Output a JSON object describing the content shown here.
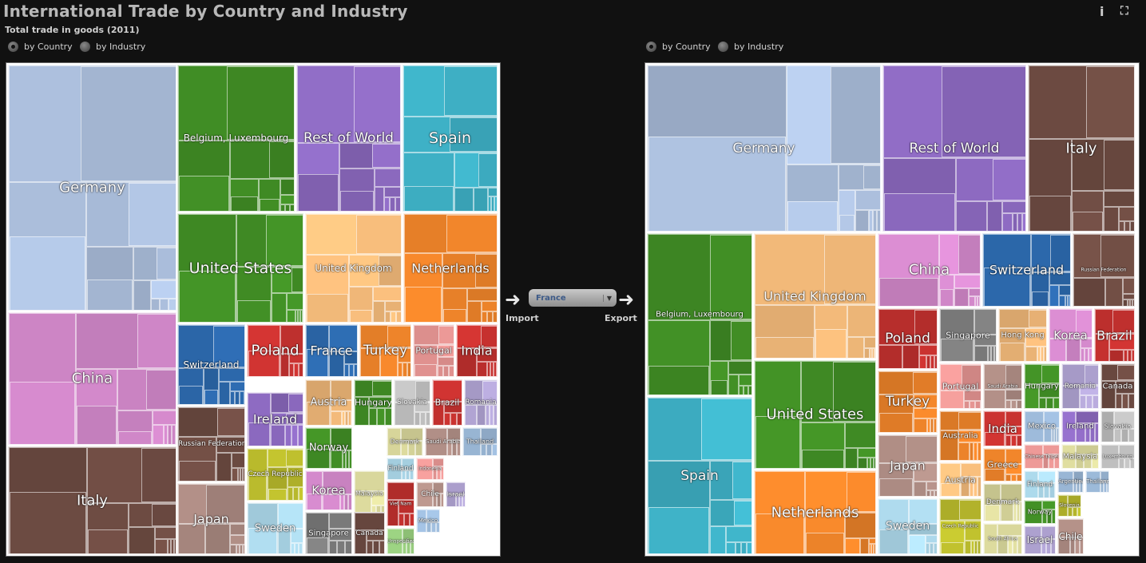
{
  "header": {
    "title": "International Trade by Country and Industry",
    "subtitle": "Total trade in goods (2011)",
    "info_icon": "info-icon",
    "fullscreen_icon": "fullscreen-icon"
  },
  "left_toggle": {
    "by_country": "by Country",
    "by_industry": "by Industry",
    "selected": "by Country"
  },
  "right_toggle": {
    "by_country": "by Country",
    "by_industry": "by Industry",
    "selected": "by Country"
  },
  "center": {
    "country": "France",
    "import_label": "Import",
    "export_label": "Export"
  },
  "colors": {
    "Germany": "#a9bcd9",
    "China": "#cf86c7",
    "Italy": "#6d4b42",
    "Belgium, Luxembourg": "#3f8a24",
    "Rest of World": "#8a68bd",
    "Spain": "#3eb0c5",
    "United States": "#3f8a24",
    "United Kingdom": "#efb778",
    "Netherlands": "#e98129",
    "Switzerland": "#2b66a8",
    "Russian Federation": "#6d4b42",
    "Japan": "#ab8a82"
  },
  "import_countries": [
    {
      "name": "Germany",
      "color": "#a9bcd9"
    },
    {
      "name": "China",
      "color": "#cf86c7"
    },
    {
      "name": "Italy",
      "color": "#6d4b42"
    },
    {
      "name": "Belgium, Luxembourg",
      "color": "#3f8a24"
    },
    {
      "name": "Rest of World",
      "color": "#8a68bd"
    },
    {
      "name": "Spain",
      "color": "#3eb0c5"
    },
    {
      "name": "United States",
      "color": "#3f8a24"
    },
    {
      "name": "United Kingdom",
      "color": "#efb778"
    },
    {
      "name": "Netherlands",
      "color": "#e98129"
    },
    {
      "name": "Switzerland",
      "color": "#2b66a8"
    },
    {
      "name": "Poland",
      "color": "#c0302e"
    },
    {
      "name": "France",
      "color": "#2b66a8"
    },
    {
      "name": "Turkey",
      "color": "#e98129"
    },
    {
      "name": "Portugal",
      "color": "#e0918f"
    },
    {
      "name": "India",
      "color": "#c0302e"
    },
    {
      "name": "Ireland",
      "color": "#8a68bd"
    },
    {
      "name": "Russian Federation",
      "color": "#6d4b42"
    },
    {
      "name": "Austria",
      "color": "#efb778"
    },
    {
      "name": "Hungary",
      "color": "#3f8a24"
    },
    {
      "name": "Slovakia",
      "color": "#b8b8b8"
    },
    {
      "name": "Brazil",
      "color": "#c0302e"
    },
    {
      "name": "Romania",
      "color": "#b3a6d6"
    },
    {
      "name": "Czech Republic",
      "color": "#b7b82c"
    },
    {
      "name": "Norway",
      "color": "#3f8a24"
    },
    {
      "name": "Denmark",
      "color": "#d7d59a"
    },
    {
      "name": "Saudi Arabia",
      "color": "#ab8a82"
    },
    {
      "name": "Thailand",
      "color": "#9ab7d6"
    },
    {
      "name": "Japan",
      "color": "#ab8a82"
    },
    {
      "name": "Korea",
      "color": "#cf86c7"
    },
    {
      "name": "Malaysia",
      "color": "#d7d59a"
    },
    {
      "name": "Finland",
      "color": "#a9d4e6"
    },
    {
      "name": "Indonesia",
      "color": "#e0918f"
    },
    {
      "name": "Sweden",
      "color": "#a9d4e6"
    },
    {
      "name": "Singapore",
      "color": "#7a7a7a"
    },
    {
      "name": "Canada",
      "color": "#6d4b42"
    },
    {
      "name": "Viet Nam",
      "color": "#c0302e"
    },
    {
      "name": "Chile",
      "color": "#ab8a82"
    },
    {
      "name": "Israel",
      "color": "#b3a6d6"
    },
    {
      "name": "Mexico",
      "color": "#9ab7d6"
    },
    {
      "name": "Unspecified",
      "color": "#8fc177"
    }
  ],
  "export_countries": [
    {
      "name": "Germany",
      "color": "#a9bcd9"
    },
    {
      "name": "Rest of World",
      "color": "#8a68bd"
    },
    {
      "name": "Italy",
      "color": "#6d4b42"
    },
    {
      "name": "Belgium, Luxembourg",
      "color": "#3f8a24"
    },
    {
      "name": "United Kingdom",
      "color": "#efb778"
    },
    {
      "name": "China",
      "color": "#cf86c7"
    },
    {
      "name": "Switzerland",
      "color": "#2b66a8"
    },
    {
      "name": "Russian Federation",
      "color": "#6d4b42"
    },
    {
      "name": "Spain",
      "color": "#3eb0c5"
    },
    {
      "name": "United States",
      "color": "#3f8a24"
    },
    {
      "name": "Netherlands",
      "color": "#e98129"
    },
    {
      "name": "Poland",
      "color": "#c0302e"
    },
    {
      "name": "Singapore",
      "color": "#7a7a7a"
    },
    {
      "name": "Hong Kong",
      "color": "#efb778"
    },
    {
      "name": "Korea",
      "color": "#cf86c7"
    },
    {
      "name": "Brazil",
      "color": "#c0302e"
    },
    {
      "name": "Turkey",
      "color": "#e98129"
    },
    {
      "name": "Portugal",
      "color": "#e0918f"
    },
    {
      "name": "Saudi Arabia",
      "color": "#ab8a82"
    },
    {
      "name": "Hungary",
      "color": "#3f8a24"
    },
    {
      "name": "Romania",
      "color": "#b3a6d6"
    },
    {
      "name": "Canada",
      "color": "#6d4b42"
    },
    {
      "name": "Australia",
      "color": "#e98129"
    },
    {
      "name": "India",
      "color": "#c0302e"
    },
    {
      "name": "Mexico",
      "color": "#9ab7d6"
    },
    {
      "name": "Ireland",
      "color": "#8a68bd"
    },
    {
      "name": "Slovakia",
      "color": "#b8b8b8"
    },
    {
      "name": "Japan",
      "color": "#ab8a82"
    },
    {
      "name": "Greece",
      "color": "#e98129"
    },
    {
      "name": "Chinese Taipei",
      "color": "#e0918f"
    },
    {
      "name": "Malaysia",
      "color": "#d7d59a"
    },
    {
      "name": "Luxembourg",
      "color": "#b8b8b8"
    },
    {
      "name": "Austria",
      "color": "#efb778"
    },
    {
      "name": "Denmark",
      "color": "#d7d59a"
    },
    {
      "name": "Finland",
      "color": "#a9d4e6"
    },
    {
      "name": "Argentina",
      "color": "#9ab7d6"
    },
    {
      "name": "Thailand",
      "color": "#9ab7d6"
    },
    {
      "name": "Sweden",
      "color": "#a9d4e6"
    },
    {
      "name": "Czech Republic",
      "color": "#b7b82c"
    },
    {
      "name": "Norway",
      "color": "#3f8a24"
    },
    {
      "name": "Slovenia",
      "color": "#b7b82c"
    },
    {
      "name": "South Africa",
      "color": "#d7d59a"
    },
    {
      "name": "Israel",
      "color": "#b3a6d6"
    },
    {
      "name": "Chile",
      "color": "#ab8a82"
    }
  ]
}
